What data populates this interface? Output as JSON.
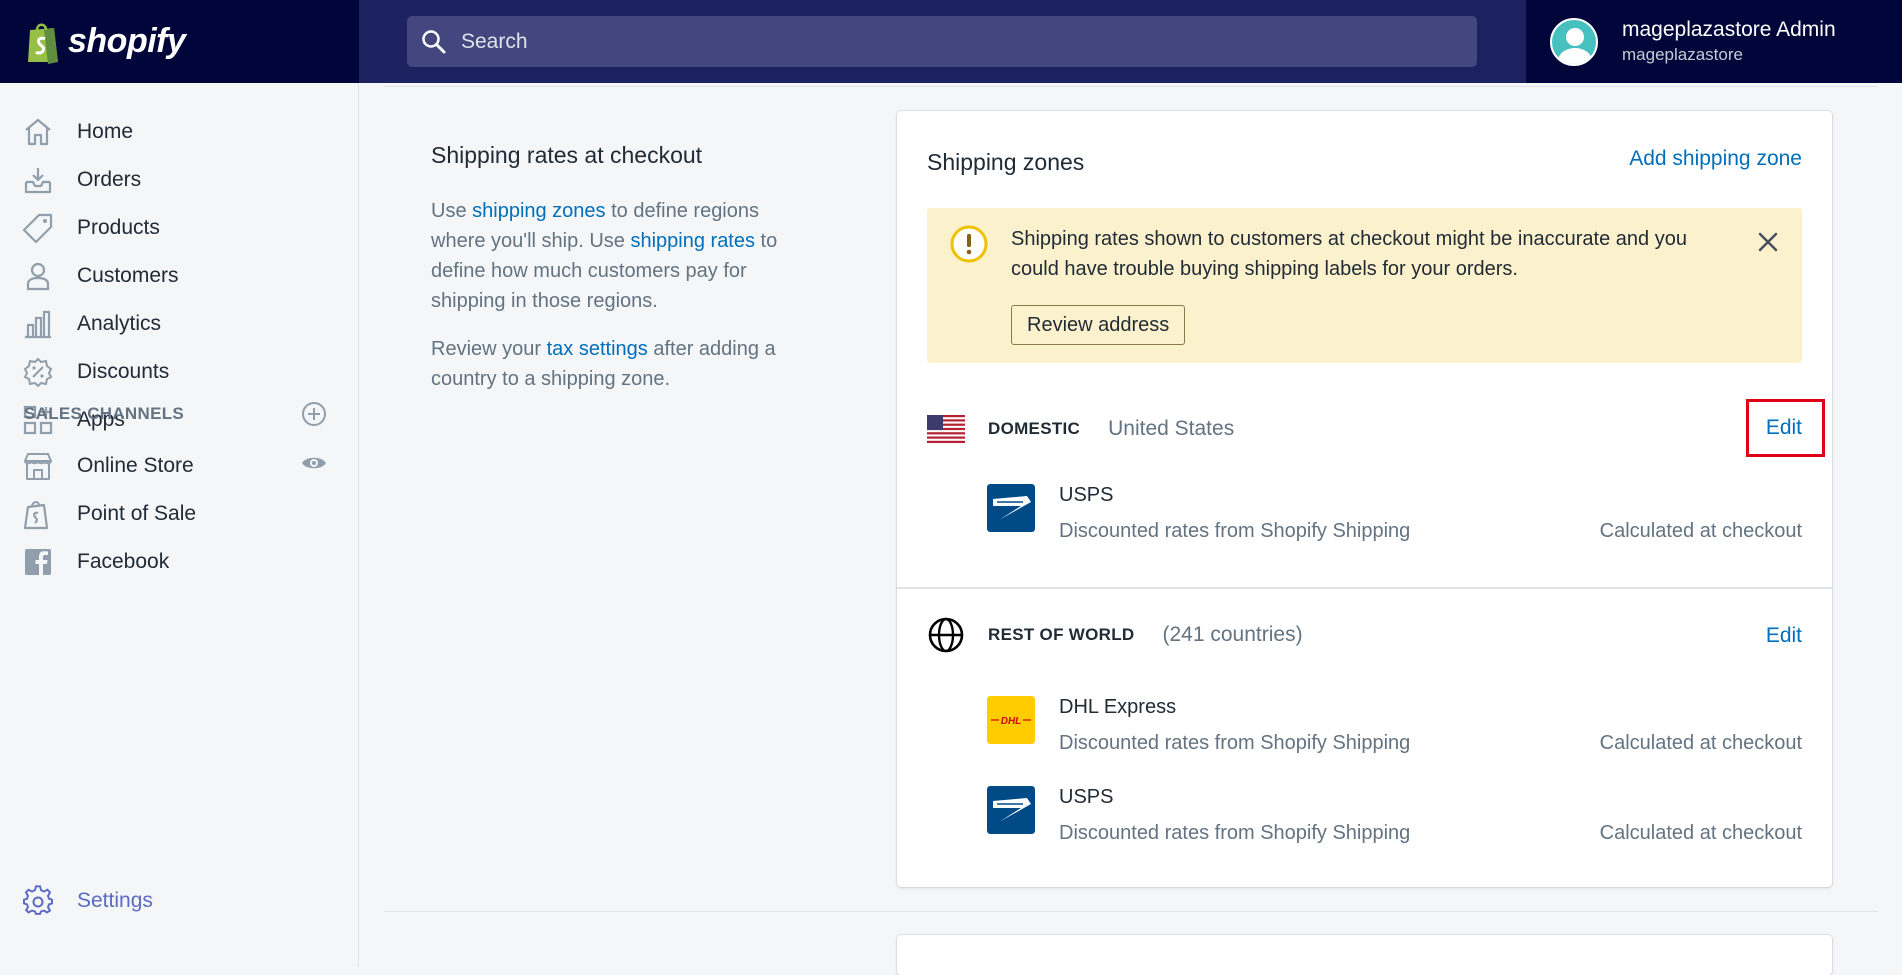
{
  "topbar": {
    "brand": "shopify",
    "search_placeholder": "Search",
    "user_name": "mageplazastore Admin",
    "user_store": "mageplazastore"
  },
  "sidebar": {
    "items": [
      {
        "label": "Home",
        "icon": "home-icon"
      },
      {
        "label": "Orders",
        "icon": "orders-icon"
      },
      {
        "label": "Products",
        "icon": "tag-icon"
      },
      {
        "label": "Customers",
        "icon": "person-icon"
      },
      {
        "label": "Analytics",
        "icon": "bar-chart-icon"
      },
      {
        "label": "Discounts",
        "icon": "discount-icon"
      },
      {
        "label": "Apps",
        "icon": "apps-icon"
      }
    ],
    "sales_channels_header": "SALES CHANNELS",
    "channels": [
      {
        "label": "Online Store",
        "icon": "store-icon"
      },
      {
        "label": "Point of Sale",
        "icon": "pos-icon"
      },
      {
        "label": "Facebook",
        "icon": "facebook-icon"
      }
    ],
    "settings_label": "Settings"
  },
  "section": {
    "title": "Shipping rates at checkout",
    "desc_part1": "Use ",
    "link_zones": "shipping zones",
    "desc_part2": " to define regions where you'll ship. Use ",
    "link_rates": "shipping rates",
    "desc_part3": " to define how much customers pay for shipping in those regions.",
    "desc2_part1": "Review your ",
    "link_tax": "tax settings",
    "desc2_part2": " after adding a country to a shipping zone."
  },
  "card": {
    "title": "Shipping zones",
    "add_zone": "Add shipping zone",
    "banner_text": "Shipping rates shown to customers at checkout might be inaccurate and you could have trouble buying shipping labels for your orders.",
    "review_button": "Review address",
    "edit_label": "Edit",
    "domestic": {
      "name": "DOMESTIC",
      "sub": "United States",
      "carriers": [
        {
          "name": "USPS",
          "desc": "Discounted rates from Shopify Shipping",
          "calc": "Calculated at checkout"
        }
      ]
    },
    "world": {
      "name": "REST OF WORLD",
      "sub": "(241 countries)",
      "carriers": [
        {
          "name": "DHL Express",
          "desc": "Discounted rates from Shopify Shipping",
          "calc": "Calculated at checkout"
        },
        {
          "name": "USPS",
          "desc": "Discounted rates from Shopify Shipping",
          "calc": "Calculated at checkout"
        }
      ]
    }
  },
  "colors": {
    "topbar_bg": "#1c2260",
    "link": "#006fbb",
    "banner_bg": "#fcf1cd",
    "highlight": "#e00017",
    "settings_accent": "#5c6ac4"
  }
}
